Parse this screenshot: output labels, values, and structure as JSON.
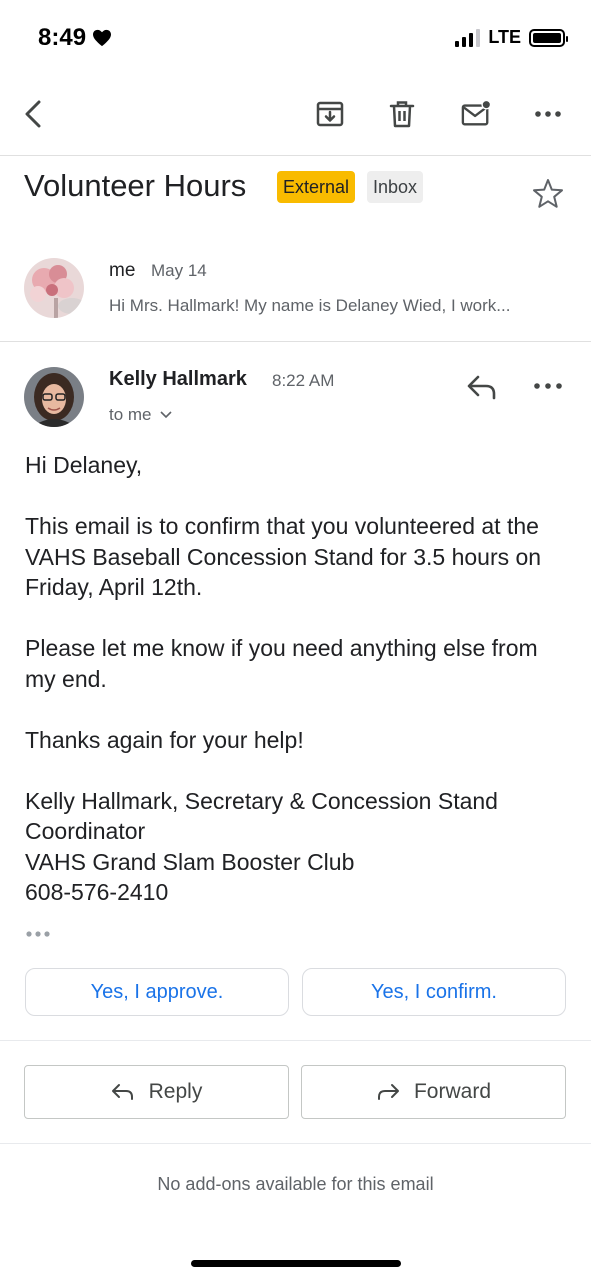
{
  "status_bar": {
    "time": "8:49",
    "network": "LTE",
    "icons": [
      "heart-icon",
      "signal-icon",
      "battery-icon"
    ]
  },
  "toolbar": {
    "icons": [
      "back-icon",
      "archive-icon",
      "trash-icon",
      "mark-unread-icon",
      "more-icon"
    ]
  },
  "subject": {
    "title": "Volunteer Hours",
    "labels": [
      "External",
      "Inbox"
    ],
    "star_icon": "star-outline-icon"
  },
  "collapsed_message": {
    "sender": "me",
    "date": "May 14",
    "snippet": "Hi Mrs. Hallmark! My name is Delaney Wied, I work..."
  },
  "open_message": {
    "sender": "Kelly Hallmark",
    "time": "8:22 AM",
    "recipient": "to me",
    "greeting": "Hi Delaney,",
    "paragraph1": "This email is to confirm that you volunteered at the VAHS Baseball Concession Stand for 3.5 hours on Friday, April 12th.",
    "paragraph2": "Please let me know if you need anything else from my end.",
    "paragraph3": "Thanks again for your help!",
    "signature": {
      "line1": "Kelly Hallmark, Secretary & Concession Stand Coordinator",
      "line2": "VAHS Grand Slam Booster Club",
      "line3": "608-576-2410"
    }
  },
  "smart_replies": [
    "Yes, I approve.",
    "Yes, I confirm."
  ],
  "actions": {
    "reply": "Reply",
    "forward": "Forward"
  },
  "footer": {
    "addons_text": "No add-ons available for this email"
  },
  "colors": {
    "accent": "#1a73e8",
    "external_label": "#f9bb00",
    "inbox_label": "#eeeeee",
    "divider": "#e0e0e0"
  }
}
